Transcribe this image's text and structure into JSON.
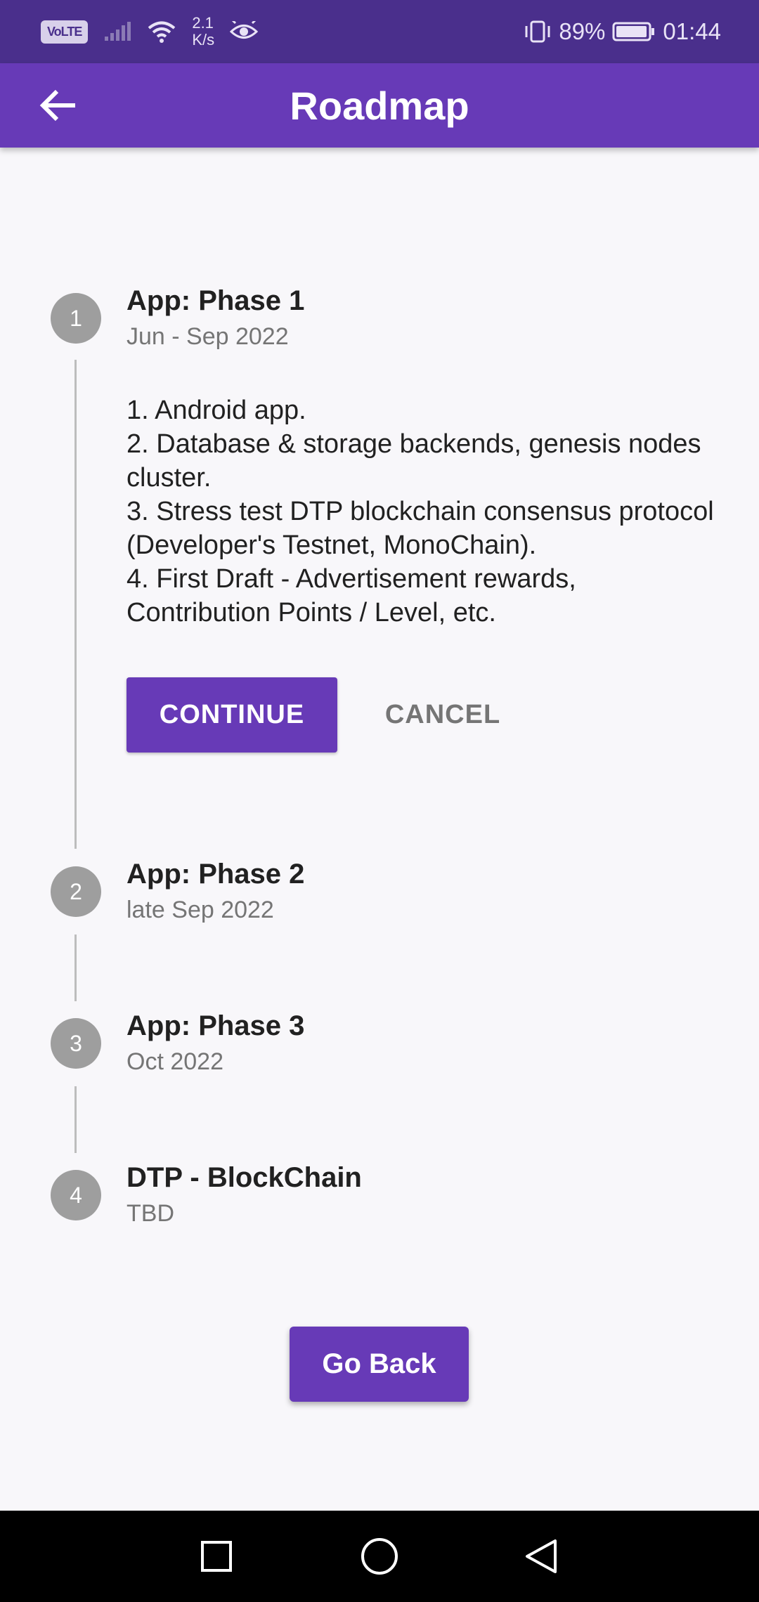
{
  "status_bar": {
    "volte": "VoLTE",
    "net_speed_value": "2.1",
    "net_speed_unit": "K/s",
    "battery": "89%",
    "time": "01:44"
  },
  "app_bar": {
    "title": "Roadmap"
  },
  "steps": [
    {
      "number": "1",
      "title": "App: Phase 1",
      "subtitle": "Jun - Sep 2022"
    },
    {
      "number": "2",
      "title": "App: Phase 2",
      "subtitle": "late Sep 2022"
    },
    {
      "number": "3",
      "title": "App: Phase 3",
      "subtitle": "Oct 2022"
    },
    {
      "number": "4",
      "title": "DTP - BlockChain",
      "subtitle": "TBD"
    }
  ],
  "step_content": {
    "lines": [
      "1. Android app.",
      "2. Database & storage backends, genesis nodes cluster.",
      "3. Stress test DTP blockchain consensus protocol (Developer's Testnet, MonoChain).",
      "4. First Draft - Advertisement rewards, Contribution Points / Level, etc."
    ],
    "continue_label": "CONTINUE",
    "cancel_label": "CANCEL"
  },
  "footer": {
    "go_back_label": "Go Back"
  },
  "colors": {
    "status_bar": "#4a2f8c",
    "primary": "#673ab7",
    "step_circle": "#9e9e9e",
    "background": "#f8f7fa"
  },
  "icons": {
    "back": "arrow-left-icon",
    "nav_recents": "square-icon",
    "nav_home": "circle-icon",
    "nav_back": "triangle-back-icon"
  }
}
